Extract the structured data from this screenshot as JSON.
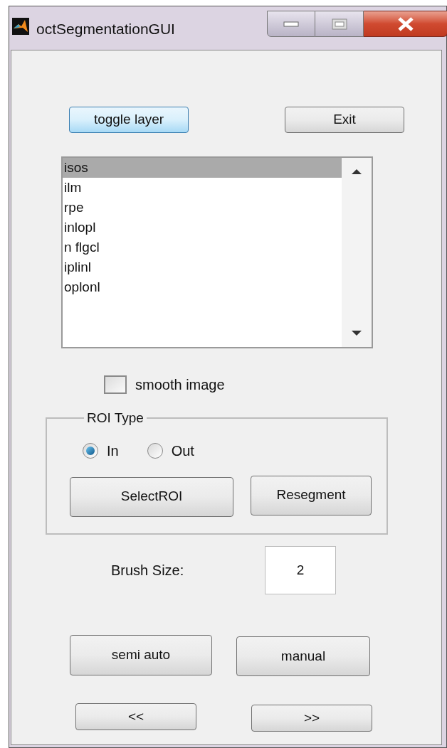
{
  "window": {
    "title": "octSegmentationGUI"
  },
  "top_buttons": [
    {
      "label": "toggle layer",
      "focused": true
    },
    {
      "label": "Exit",
      "focused": false
    }
  ],
  "list": {
    "items": [
      {
        "label": "isos",
        "selected": true
      },
      {
        "label": "ilm",
        "selected": false
      },
      {
        "label": "rpe",
        "selected": false
      },
      {
        "label": "inlopl",
        "selected": false
      },
      {
        "label": "n flgcl",
        "selected": false
      },
      {
        "label": "iplinl",
        "selected": false
      },
      {
        "label": "oplonl",
        "selected": false
      }
    ]
  },
  "checkbox": {
    "label": "smooth image",
    "checked": false
  },
  "roi_group": {
    "title": "ROI Type",
    "radios": [
      {
        "label": "In",
        "selected": true
      },
      {
        "label": "Out",
        "selected": false
      }
    ],
    "buttons": [
      "SelectROI",
      "Resegment"
    ]
  },
  "brush": {
    "label": "Brush Size:",
    "value": "2"
  },
  "mode_buttons": [
    "semi auto",
    "manual"
  ],
  "nav_buttons": [
    "<<",
    ">>"
  ]
}
